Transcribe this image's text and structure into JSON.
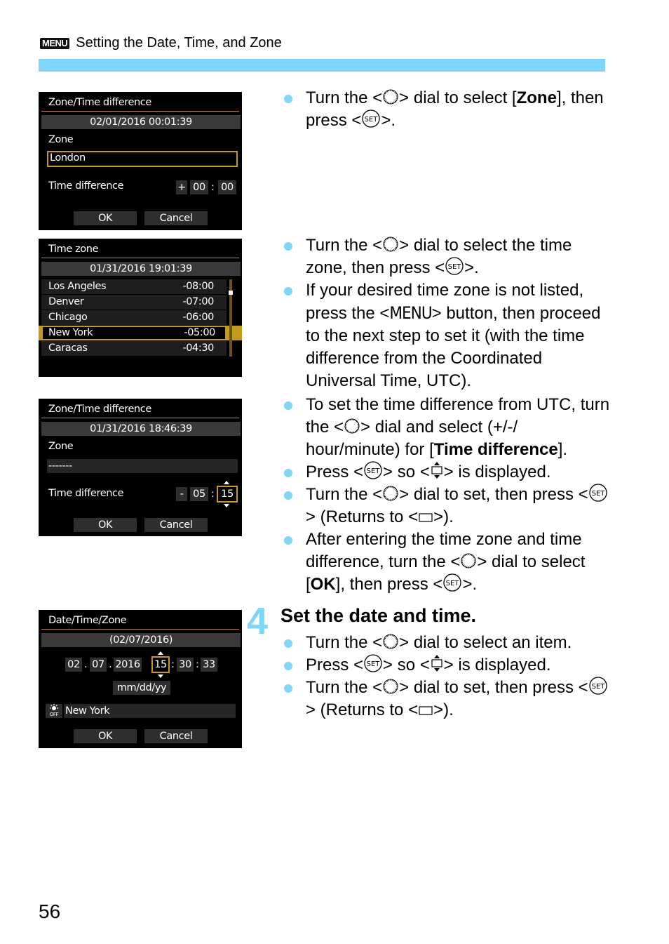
{
  "header": {
    "menu_badge": "MENU",
    "title": "Setting the Date, Time, and Zone",
    "accent_color": "#7fd5fa"
  },
  "screens": {
    "zone1": {
      "title": "Zone/Time difference",
      "datetime": "02/01/2016 00:01:39",
      "zone_label": "Zone",
      "zone_value": "London",
      "time_diff_label": "Time difference",
      "sign": "+",
      "hours": "00",
      "minutes": "00",
      "colon": ":",
      "ok": "OK",
      "cancel": "Cancel"
    },
    "timezone": {
      "title": "Time zone",
      "datetime": "01/31/2016 19:01:39",
      "rows": [
        {
          "name": "Los Angeles",
          "offset": "-08:00"
        },
        {
          "name": "Denver",
          "offset": "-07:00"
        },
        {
          "name": "Chicago",
          "offset": "-06:00"
        },
        {
          "name": "New York",
          "offset": "-05:00",
          "selected": true
        },
        {
          "name": "Caracas",
          "offset": "-04:30"
        }
      ]
    },
    "zone2": {
      "title": "Zone/Time difference",
      "datetime": "01/31/2016 18:46:39",
      "zone_label": "Zone",
      "zone_value": "-------",
      "time_diff_label": "Time difference",
      "sign": "-",
      "hours": "05",
      "minutes": "15",
      "colon": ":",
      "ok": "OK",
      "cancel": "Cancel"
    },
    "datetime": {
      "title": "Date/Time/Zone",
      "date_display": "(02/07/2016)",
      "month": "02",
      "day": "07",
      "year": "2016",
      "hour": "15",
      "minute": "30",
      "second": "33",
      "dot": ".",
      "colon": ":",
      "format": "mm/dd/yy",
      "dst_icon": "dst-off-icon",
      "zone": "New York",
      "ok": "OK",
      "cancel": "Cancel"
    }
  },
  "instructions": {
    "block1": [
      [
        "Turn the <",
        "dial",
        "> dial to select [",
        {
          "b": "Zone"
        },
        "], then press <",
        "set",
        ">."
      ]
    ],
    "block2": [
      [
        "Turn the <",
        "dial",
        "> dial to select the time zone, then press <",
        "set",
        ">."
      ],
      [
        "If your desired time zone is not listed, press the <",
        {
          "menu": "MENU"
        },
        "> button, then proceed to the next step to set it (with the time difference from the Coordinated Universal Time, UTC)."
      ]
    ],
    "block3": [
      [
        "To set the time difference from UTC, turn the <",
        "dial",
        "> dial and select (+/-/ hour/minute) for [",
        {
          "b": "Time difference"
        },
        "]."
      ],
      [
        "Press <",
        "set",
        "> so <",
        "updown",
        "> is displayed."
      ],
      [
        "Turn the <",
        "dial",
        "> dial to set, then press <",
        "set",
        "> (Returns to <",
        "rect",
        ">)."
      ],
      [
        "After entering the time zone and time difference, turn the <",
        "dial",
        "> dial to select [",
        {
          "b": "OK"
        },
        "], then press <",
        "set",
        ">."
      ]
    ],
    "step4": {
      "number": "4",
      "title": "Set the date and time.",
      "bullets": [
        [
          "Turn the <",
          "dial",
          "> dial to select an item."
        ],
        [
          "Press <",
          "set",
          "> so <",
          "updown",
          "> is displayed."
        ],
        [
          "Turn the <",
          "dial",
          "> dial to set, then press <",
          "set",
          "> (Returns to <",
          "rect",
          ">)."
        ]
      ]
    }
  },
  "page_number": "56"
}
